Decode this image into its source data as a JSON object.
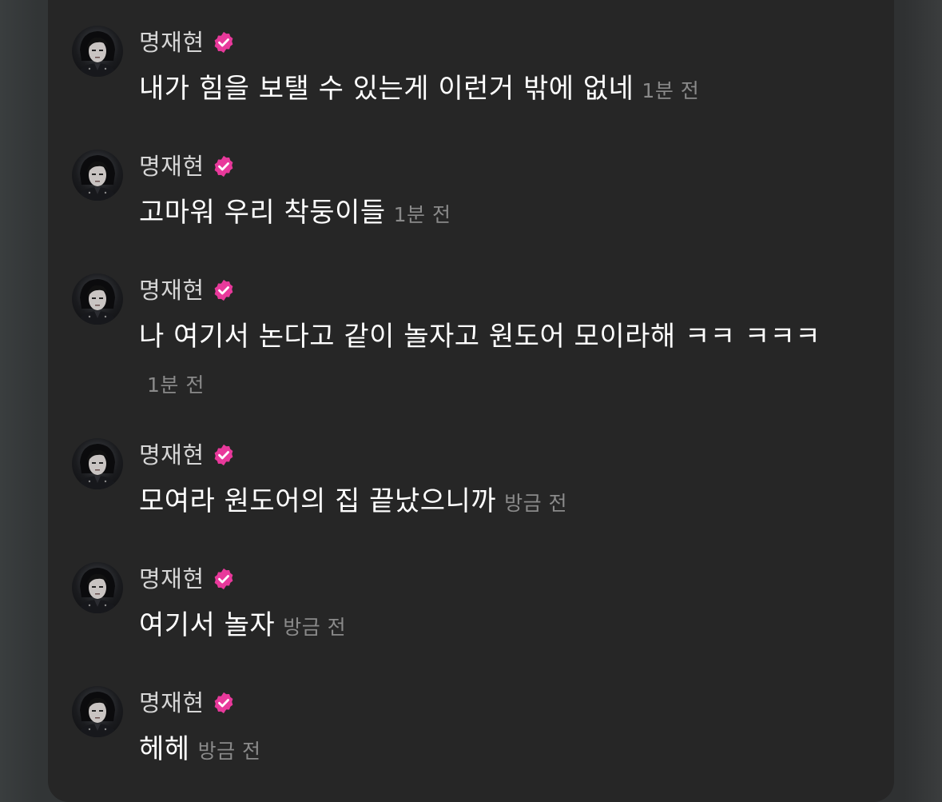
{
  "messages": [
    {
      "name": "명재현",
      "text": "내가 힘을 보탤 수 있는게 이런거 밖에 없네",
      "time": "1분 전"
    },
    {
      "name": "명재현",
      "text": "고마워 우리 착둥이들",
      "time": "1분 전"
    },
    {
      "name": "명재현",
      "text": "나 여기서 논다고 같이 놀자고 원도어 모이라해 ㅋㅋ ㅋㅋㅋ",
      "time": "1분 전"
    },
    {
      "name": "명재현",
      "text": "모여라 원도어의 집 끝났으니까",
      "time": "방금 전"
    },
    {
      "name": "명재현",
      "text": "여기서 놀자",
      "time": "방금 전"
    },
    {
      "name": "명재현",
      "text": "헤헤",
      "time": "방금 전"
    }
  ],
  "colors": {
    "panel_bg": "#262626",
    "verified_badge": "#e8399b",
    "timestamp": "#8a8a8a"
  },
  "icons": {
    "verified": "verified-badge-icon",
    "avatar": "profile-avatar"
  }
}
